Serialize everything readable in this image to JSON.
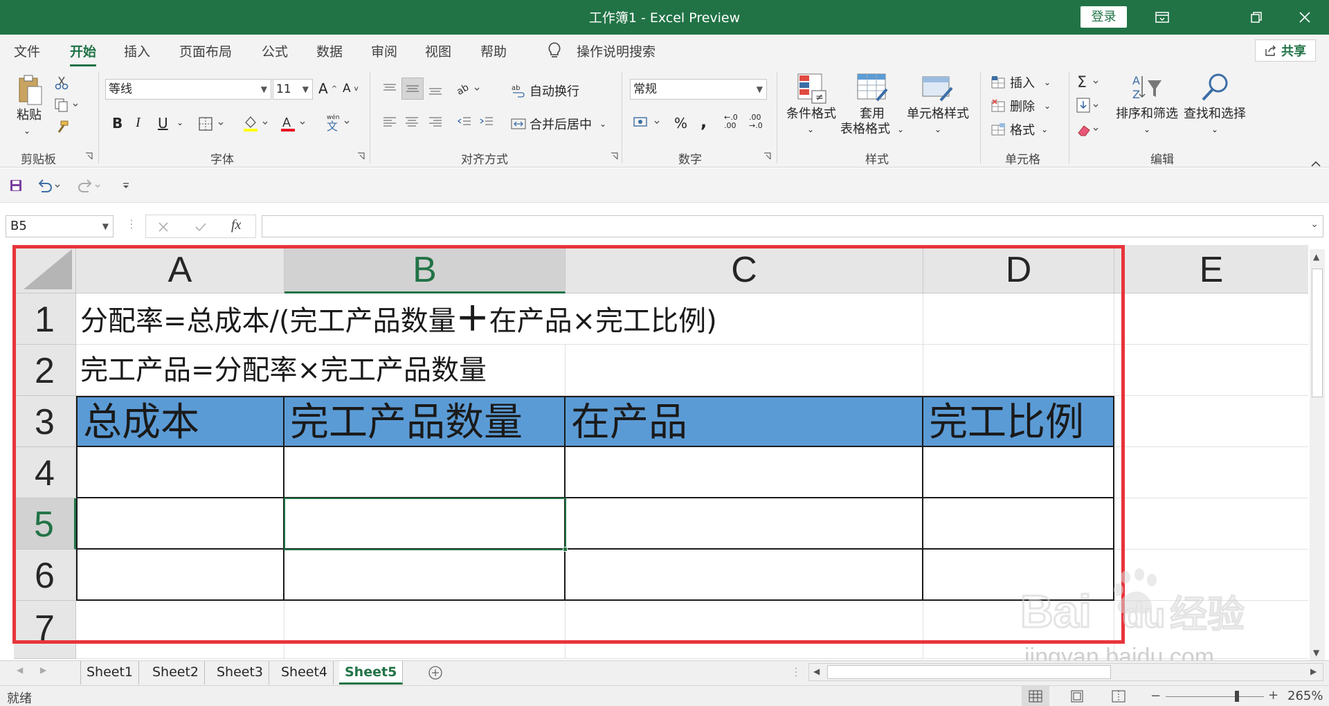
{
  "window": {
    "title": "工作簿1  -  Excel Preview",
    "login_label": "登录"
  },
  "menu": {
    "tabs": [
      "文件",
      "开始",
      "插入",
      "页面布局",
      "公式",
      "数据",
      "审阅",
      "视图",
      "帮助"
    ],
    "active_tab": "开始",
    "tell_me": "操作说明搜索",
    "share_label": "共享"
  },
  "ribbon": {
    "clipboard": {
      "paste_label": "粘贴",
      "group_label": "剪贴板"
    },
    "font": {
      "font_name": "等线",
      "font_size": "11",
      "bold": "B",
      "italic": "I",
      "underline": "U",
      "group_label": "字体"
    },
    "alignment": {
      "wrap_text": "自动换行",
      "merge_center": "合并后居中",
      "group_label": "对齐方式"
    },
    "number": {
      "format": "常规",
      "percent": "%",
      "comma": ",",
      "inc_decimal": "←.0 .00",
      "dec_decimal": ".00 →.0",
      "group_label": "数字"
    },
    "styles": {
      "conditional": "条件格式",
      "table_format_1": "套用",
      "table_format_2": "表格格式",
      "cell_styles": "单元格样式",
      "group_label": "样式"
    },
    "cells": {
      "insert": "插入",
      "delete": "删除",
      "format": "格式",
      "group_label": "单元格"
    },
    "editing": {
      "sort_filter": "排序和筛选",
      "find_select": "查找和选择",
      "group_label": "编辑"
    }
  },
  "formula_bar": {
    "name_box": "B5",
    "fx": "fx",
    "content": ""
  },
  "grid": {
    "columns": [
      "A",
      "B",
      "C",
      "D",
      "E"
    ],
    "selected_column": "B",
    "rows": [
      "1",
      "2",
      "3",
      "4",
      "5",
      "6",
      "7"
    ],
    "selected_row": "5",
    "row1_text": "分配率=总成本/(完工产品数量",
    "row1_plus": "＋",
    "row1_text2": "在产品×完工比例)",
    "row2_text": "完工产品=分配率×完工产品数量",
    "headers": [
      "总成本",
      "完工产品数量",
      "在产品",
      "完工比例"
    ],
    "header_color": "#5b9bd5",
    "highlight_color": "#e8343a"
  },
  "sheets": {
    "tabs": [
      "Sheet1",
      "Sheet2",
      "Sheet3",
      "Sheet4",
      "Sheet5"
    ],
    "active": "Sheet5"
  },
  "status": {
    "ready": "就绪",
    "zoom": "265%"
  },
  "watermark": {
    "brand": "Bai",
    "brand2": "du",
    "cn": "经验",
    "sub": "jingyan.baidu.com"
  },
  "colors": {
    "accent": "#217346"
  }
}
